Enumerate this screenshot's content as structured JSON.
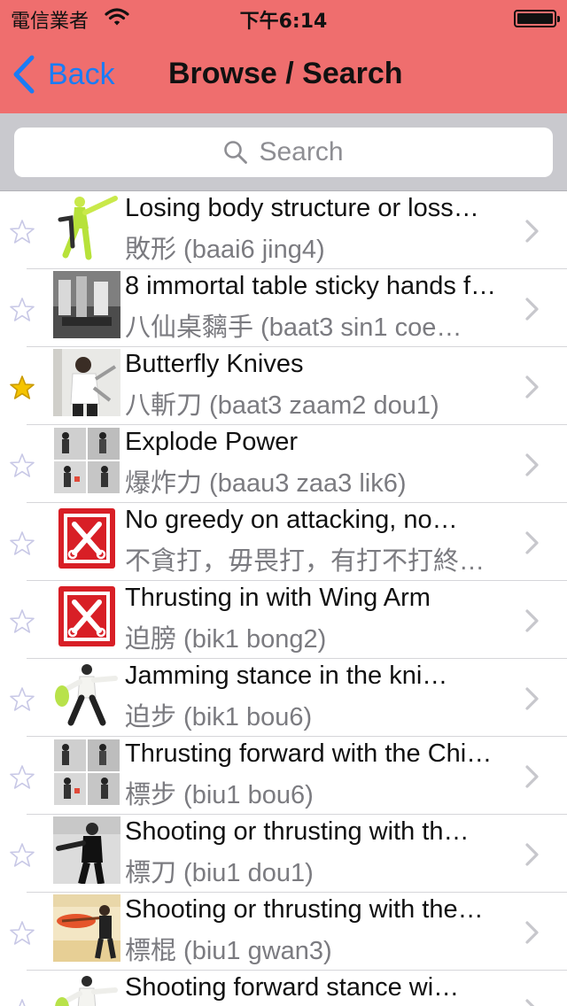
{
  "status_bar": {
    "carrier": "電信業者",
    "time": "下午6:14"
  },
  "nav": {
    "back_label": "Back",
    "title": "Browse / Search"
  },
  "search": {
    "placeholder": "Search"
  },
  "colors": {
    "nav_bar": "#ef6e6e",
    "back_tint": "#1a7cf5",
    "star_on": "#f5c400",
    "star_off": "#d7d7f2"
  },
  "items": [
    {
      "title": "Losing body structure or loss…",
      "subtitle": "敗形 (baai6 jing4)",
      "favorite": false,
      "thumb": "figure-kick"
    },
    {
      "title": "8 immortal table sticky hands f…",
      "subtitle": "八仙桌黐手 (baat3 sin1 coe…",
      "favorite": false,
      "thumb": "photo-bw"
    },
    {
      "title": "Butterfly Knives",
      "subtitle": "八斬刀 (baat3 zaam2 dou1)",
      "favorite": true,
      "thumb": "photo-knives"
    },
    {
      "title": "Explode Power",
      "subtitle": "爆炸力 (baau3 zaa3 lik6)",
      "favorite": false,
      "thumb": "photo-grid"
    },
    {
      "title": "No greedy on attacking, no…",
      "subtitle": "不貪打，毋畏打，有打不打終…",
      "favorite": false,
      "thumb": "logo-knives"
    },
    {
      "title": "Thrusting in with Wing Arm",
      "subtitle": "迫膀 (bik1 bong2)",
      "favorite": false,
      "thumb": "logo-knives"
    },
    {
      "title": "Jamming stance in the kni…",
      "subtitle": "迫步 (bik1 bou6)",
      "favorite": false,
      "thumb": "figure-stance"
    },
    {
      "title": "Thrusting forward with the Chi…",
      "subtitle": "標步 (biu1 bou6)",
      "favorite": false,
      "thumb": "photo-grid"
    },
    {
      "title": "Shooting or thrusting with th…",
      "subtitle": "標刀 (biu1 dou1)",
      "favorite": false,
      "thumb": "photo-dark"
    },
    {
      "title": "Shooting or thrusting with the…",
      "subtitle": "標棍 (biu1 gwan3)",
      "favorite": false,
      "thumb": "photo-pole"
    },
    {
      "title": "Shooting forward stance wi…",
      "subtitle": "",
      "favorite": false,
      "thumb": "figure-stance"
    }
  ]
}
